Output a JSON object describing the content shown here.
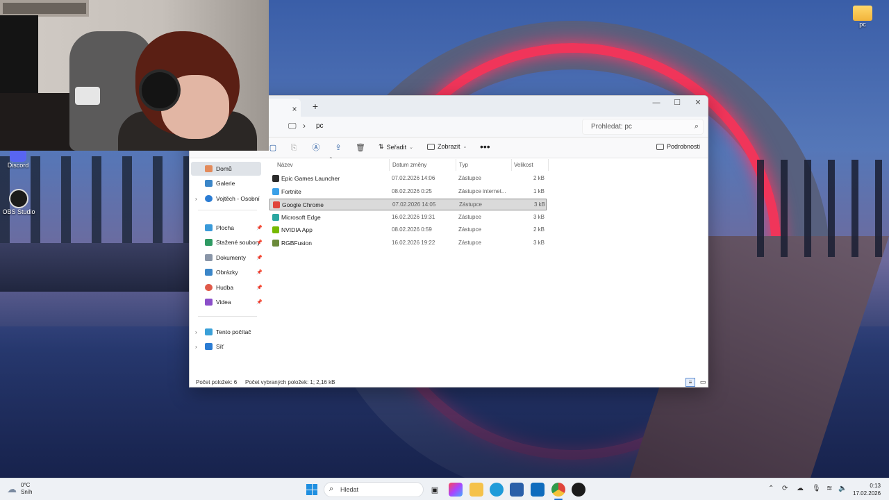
{
  "desktop": {
    "icons": [
      {
        "label": "Discord"
      },
      {
        "label": "OBS Studio"
      },
      {
        "label": "pc"
      }
    ]
  },
  "explorer": {
    "tab_close": "×",
    "tab_new": "+",
    "window_controls": {
      "minimize": "—",
      "maximize": "☐",
      "close": "✕"
    },
    "breadcrumb": [
      "pc"
    ],
    "search_placeholder": "Prohledat: pc",
    "toolbar": {
      "sort_label": "Seřadit",
      "view_label": "Zobrazit",
      "more_label": "•••",
      "details_label": "Podrobnosti"
    },
    "nav": {
      "top": [
        {
          "label": "Domů",
          "selected": true
        },
        {
          "label": "Galerie"
        },
        {
          "label": "Vojtěch - Osobní"
        }
      ],
      "quick": [
        {
          "label": "Plocha"
        },
        {
          "label": "Stažené soubory"
        },
        {
          "label": "Dokumenty"
        },
        {
          "label": "Obrázky"
        },
        {
          "label": "Hudba"
        },
        {
          "label": "Videa"
        }
      ],
      "bottom": [
        {
          "label": "Tento počítač"
        },
        {
          "label": "Síť"
        }
      ]
    },
    "columns": {
      "name": "Název",
      "date": "Datum změny",
      "type": "Typ",
      "size": "Velikost"
    },
    "files": [
      {
        "name": "Epic Games Launcher",
        "date": "07.02.2026 14:06",
        "type": "Zástupce",
        "size": "2 kB",
        "icon_color": "#2b2b2b"
      },
      {
        "name": "Fortnite",
        "date": "08.02.2026 0:25",
        "type": "Zástupce internet...",
        "size": "1 kB",
        "icon_color": "#3aa0e8"
      },
      {
        "name": "Google Chrome",
        "date": "07.02.2026 14:05",
        "type": "Zástupce",
        "size": "3 kB",
        "icon_color": "#e0443b",
        "selected": true
      },
      {
        "name": "Microsoft Edge",
        "date": "16.02.2026 19:31",
        "type": "Zástupce",
        "size": "3 kB",
        "icon_color": "#2aa6a0"
      },
      {
        "name": "NVIDIA App",
        "date": "08.02.2026 0:59",
        "type": "Zástupce",
        "size": "2 kB",
        "icon_color": "#76b900"
      },
      {
        "name": "RGBFusion",
        "date": "16.02.2026 19:22",
        "type": "Zástupce",
        "size": "3 kB",
        "icon_color": "#6b8a3a"
      }
    ],
    "status": {
      "count": "Počet položek: 6",
      "selected": "Počet vybraných položek: 1; 2,16 kB"
    }
  },
  "taskbar": {
    "weather_temp": "0°C",
    "weather_desc": "Sníh",
    "search_placeholder": "Hledat",
    "time": "0:13",
    "date": "17.02.2026"
  }
}
